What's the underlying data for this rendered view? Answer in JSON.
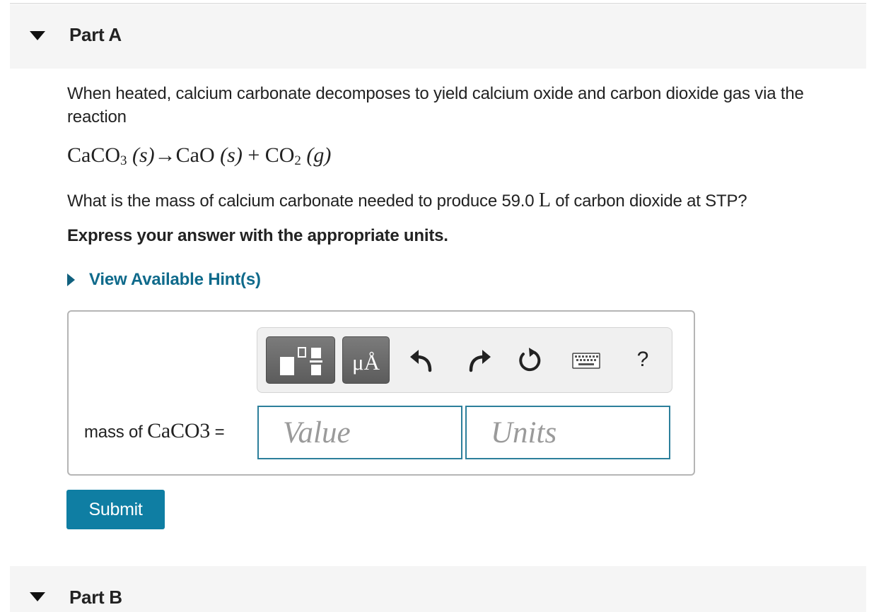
{
  "part_a": {
    "title": "Part A"
  },
  "question": {
    "intro": "When heated, calcium carbonate decomposes to yield calcium oxide and carbon dioxide gas via the reaction",
    "equation": {
      "reactant": "CaCO",
      "reactant_sub": "3",
      "reactant_state": " (s)",
      "arrow": "→",
      "product1": "CaO",
      "product1_state": " (s)",
      "plus": " + ",
      "product2": "CO",
      "product2_sub": "2",
      "product2_state": " (g)"
    },
    "ask_before": "What is the mass of calcium carbonate needed to produce 59.0 ",
    "ask_unit": "L",
    "ask_after": " of carbon dioxide at STP?",
    "instruction": "Express your answer with the appropriate units."
  },
  "hint": {
    "label": "View Available Hint(s)"
  },
  "toolbar": {
    "units_label": "μÅ",
    "help_label": "?",
    "icons": [
      "templates-icon",
      "undo-icon",
      "redo-icon",
      "reset-icon",
      "keyboard-icon"
    ]
  },
  "answer": {
    "label_text": "mass of ",
    "label_formula": "CaCO3",
    "label_equals": " =",
    "value_placeholder": "Value",
    "units_placeholder": "Units"
  },
  "submit": {
    "label": "Submit"
  },
  "part_b": {
    "title": "Part B"
  },
  "colors": {
    "accent": "#0f7ea3",
    "link": "#0f6a8b",
    "input_border": "#2c7f9b"
  }
}
